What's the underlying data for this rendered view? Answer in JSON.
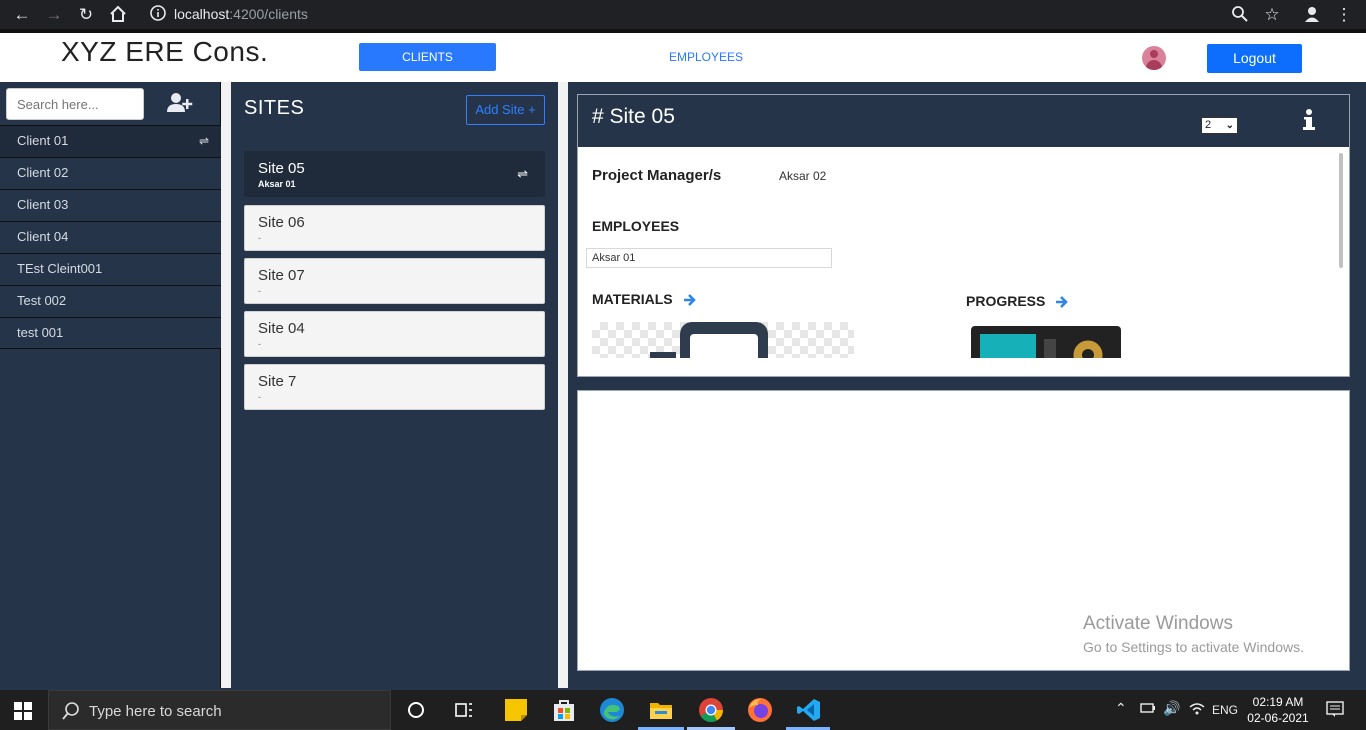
{
  "browser": {
    "url_host": "localhost",
    "url_path": ":4200/clients"
  },
  "header": {
    "brand": "XYZ ERE Cons.",
    "nav_clients": "CLIENTS",
    "nav_employees": "EMPLOYEES",
    "logout": "Logout"
  },
  "clients": {
    "search_placeholder": "Search here...",
    "items": [
      {
        "label": "Client 01"
      },
      {
        "label": "Client 02"
      },
      {
        "label": "Client 03"
      },
      {
        "label": "Client 04"
      },
      {
        "label": "TEst Cleint001"
      },
      {
        "label": "Test 002"
      },
      {
        "label": "test 001"
      }
    ],
    "swap_glyph": "⇌"
  },
  "sites": {
    "title": "SITES",
    "add_label": "Add Site +",
    "items": [
      {
        "name": "Site 05",
        "sub": "Aksar 01"
      },
      {
        "name": "Site 06",
        "sub": "-"
      },
      {
        "name": "Site 07",
        "sub": "-"
      },
      {
        "name": "Site 04",
        "sub": "-"
      },
      {
        "name": "Site 7",
        "sub": "-"
      }
    ]
  },
  "detail": {
    "title": "# Site 05",
    "select_value": "2",
    "pm_label": "Project Manager/s",
    "pm_value": "Aksar 02",
    "employees_label": "EMPLOYEES",
    "employees": [
      "Aksar 01"
    ],
    "materials_label": "MATERIALS",
    "progress_label": "PROGRESS"
  },
  "watermark": {
    "line1": "Activate Windows",
    "line2": "Go to Settings to activate Windows."
  },
  "taskbar": {
    "search_text": "Type here to search",
    "lang": "ENG",
    "time": "02:19 AM",
    "date": "02-06-2021"
  },
  "colors": {
    "panel": "#26344a",
    "accent": "#2979ff",
    "logout": "#0d6efd"
  }
}
